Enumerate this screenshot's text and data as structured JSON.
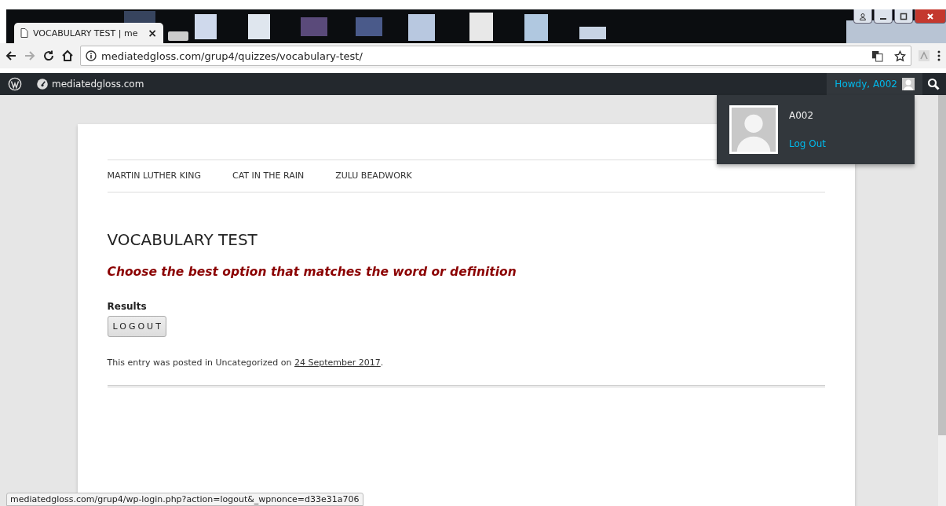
{
  "browser": {
    "tab": {
      "title": "VOCABULARY TEST | me",
      "close": "×"
    },
    "address": "mediatedgloss.com/grup4/quizzes/vocabulary-test/",
    "status_url": "mediatedgloss.com/grup4/wp-login.php?action=logout&_wpnonce=d33e31a706"
  },
  "admin_bar": {
    "site": "mediatedgloss.com",
    "greeting": "Howdy, A002",
    "dropdown": {
      "open": true,
      "username": "A002",
      "logout": "Log Out"
    }
  },
  "menu": [
    {
      "label": "MARTIN LUTHER KING"
    },
    {
      "label": "CAT IN THE RAIN"
    },
    {
      "label": "ZULU BEADWORK"
    }
  ],
  "post": {
    "title": "VOCABULARY TEST",
    "subtitle": "Choose the best option that matches the word or definition",
    "results_label": "Results",
    "button": "LOGOUT",
    "meta_before": "This entry was posted in Uncategorized on ",
    "meta_date": "24 September 2017",
    "meta_after": "."
  }
}
